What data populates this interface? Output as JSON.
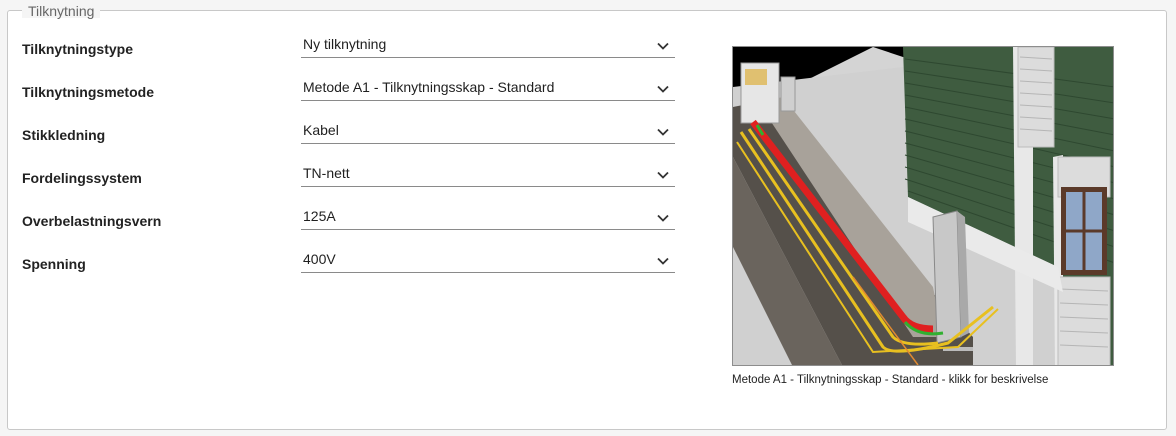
{
  "section": {
    "title": "Tilknytning"
  },
  "fields": [
    {
      "label": "Tilknytningstype",
      "value": "Ny tilknytning"
    },
    {
      "label": "Tilknytningsmetode",
      "value": "Metode A1 - Tilknytningsskap - Standard"
    },
    {
      "label": "Stikkledning",
      "value": "Kabel"
    },
    {
      "label": "Fordelingssystem",
      "value": "TN-nett"
    },
    {
      "label": "Overbelastningsvern",
      "value": "125A"
    },
    {
      "label": "Spenning",
      "value": "400V"
    }
  ],
  "illustration": {
    "caption": "Metode A1 - Tilknytningsskap - Standard - klikk for beskrivelse",
    "colors": {
      "wall": "#3d5a3f",
      "ground": "#cfcfcf",
      "cable_red": "#e02020",
      "cable_yellow": "#e8c020",
      "cable_green": "#30b030"
    }
  },
  "icons": {
    "dropdown": "chevron-down-icon"
  }
}
